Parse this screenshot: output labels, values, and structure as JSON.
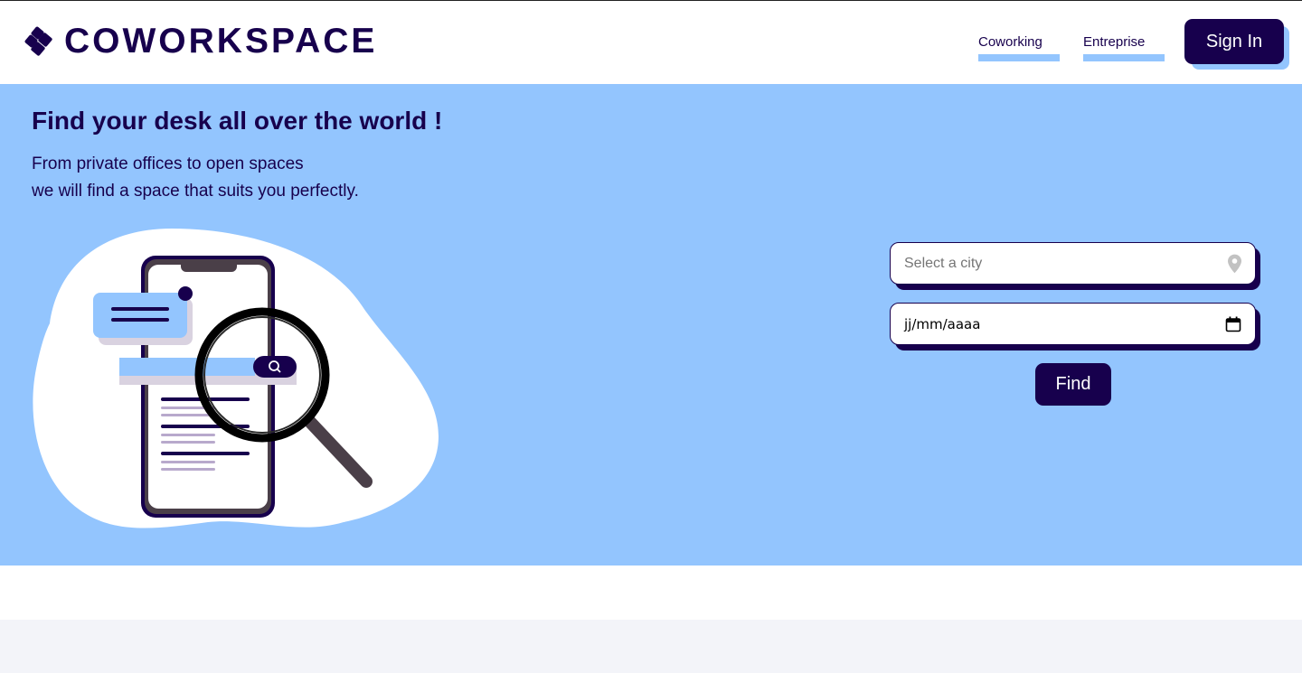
{
  "brand": {
    "name": "COWORKSPACE"
  },
  "nav": {
    "items": [
      {
        "label": "Coworking"
      },
      {
        "label": "Entreprise"
      }
    ],
    "signin_label": "Sign In"
  },
  "hero": {
    "title": "Find your desk all over the world !",
    "subtitle_line1": "From private offices to open spaces",
    "subtitle_line2": "we will find a space that suits you perfectly."
  },
  "search": {
    "city_placeholder": "Select a city",
    "date_value": "jj/mm/aaaa",
    "find_label": "Find"
  },
  "icons": {
    "logo": "cube-cluster-icon",
    "location": "map-pin-icon",
    "calendar": "calendar-icon",
    "search": "search-icon"
  },
  "colors": {
    "primary": "#17004d",
    "accent": "#93c5fe",
    "background": "#f3f4f9"
  }
}
